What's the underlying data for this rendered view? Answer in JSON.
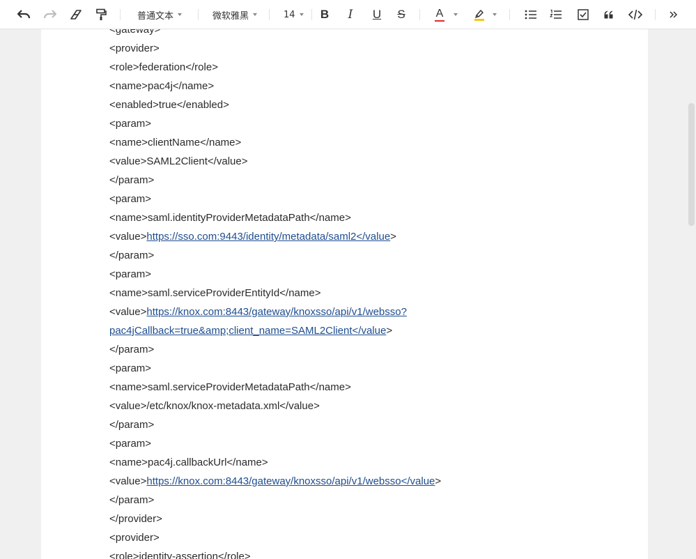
{
  "toolbar": {
    "paragraph_style": "普通文本",
    "font_family": "微软雅黑",
    "font_size": "14",
    "bold": "B",
    "italic": "I",
    "underline": "U",
    "strike": "S",
    "font_color_letter": "A",
    "font_color": "#e0292f",
    "highlight_color": "#f5c518"
  },
  "editor": {
    "lines": [
      {
        "type": "text",
        "text": "<gateway>"
      },
      {
        "type": "text",
        "text": "<provider>"
      },
      {
        "type": "text",
        "text": "<role>federation</role>"
      },
      {
        "type": "text",
        "text": "<name>pac4j</name>"
      },
      {
        "type": "text",
        "text": "<enabled>true</enabled>"
      },
      {
        "type": "text",
        "text": "<param>"
      },
      {
        "type": "text",
        "text": "<name>clientName</name>"
      },
      {
        "type": "text",
        "text": "<value>SAML2Client</value>"
      },
      {
        "type": "text",
        "text": "</param>"
      },
      {
        "type": "text",
        "text": "<param>"
      },
      {
        "type": "text",
        "text": "<name>saml.identityProviderMetadataPath</name>"
      },
      {
        "type": "link",
        "pre": "<value>",
        "link": "https://sso.com:9443/identity/metadata/saml2</value",
        "post": ">"
      },
      {
        "type": "text",
        "text": "</param>"
      },
      {
        "type": "text",
        "text": "<param>"
      },
      {
        "type": "text",
        "text": "<name>saml.serviceProviderEntityId</name>"
      },
      {
        "type": "link",
        "pre": "<value>",
        "link": "https://knox.com:8443/gateway/knoxsso/api/v1/websso?",
        "post": ""
      },
      {
        "type": "link",
        "pre": "",
        "link": "pac4jCallback=true&amp;client_name=SAML2Client</value",
        "post": ">"
      },
      {
        "type": "text",
        "text": "</param>"
      },
      {
        "type": "text",
        "text": "<param>"
      },
      {
        "type": "text",
        "text": "<name>saml.serviceProviderMetadataPath</name>"
      },
      {
        "type": "text",
        "text": "<value>/etc/knox/knox-metadata.xml</value>"
      },
      {
        "type": "text",
        "text": "</param>"
      },
      {
        "type": "text",
        "text": "<param>"
      },
      {
        "type": "text",
        "text": "<name>pac4j.callbackUrl</name>"
      },
      {
        "type": "link",
        "pre": "<value>",
        "link": "https://knox.com:8443/gateway/knoxsso/api/v1/websso</value",
        "post": ">"
      },
      {
        "type": "text",
        "text": "</param>"
      },
      {
        "type": "text",
        "text": "</provider>"
      },
      {
        "type": "text",
        "text": "<provider>"
      },
      {
        "type": "text",
        "text": "<role>identity-assertion</role>"
      }
    ]
  }
}
